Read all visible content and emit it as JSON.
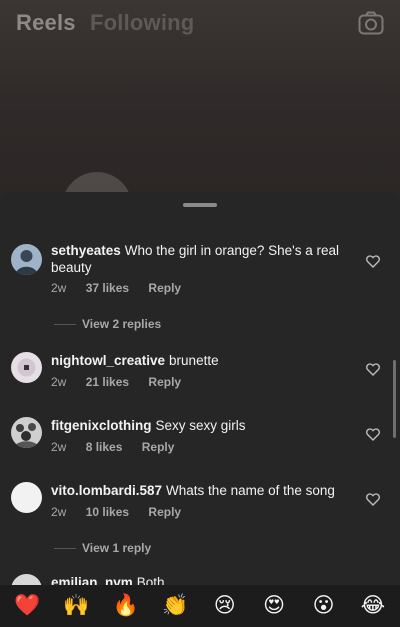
{
  "header": {
    "tabs": [
      {
        "label": "Reels"
      },
      {
        "label": "Following"
      }
    ]
  },
  "comments": [
    {
      "username": "sethyeates",
      "text": "Who the girl in orange? She's a real beauty",
      "time": "2w",
      "likes": "37 likes",
      "reply": "Reply",
      "view_replies": "View 2 replies"
    },
    {
      "username": "nightowl_creative",
      "text": "brunette",
      "time": "2w",
      "likes": "21 likes",
      "reply": "Reply"
    },
    {
      "username": "fitgenixclothing",
      "text": "Sexy sexy girls",
      "time": "2w",
      "likes": "8 likes",
      "reply": "Reply"
    },
    {
      "username": "vito.lombardi.587",
      "text": "Whats the name of the song",
      "time": "2w",
      "likes": "10 likes",
      "reply": "Reply",
      "view_replies": "View 1 reply"
    },
    {
      "username": "emilian_nvm",
      "text": "Both"
    }
  ],
  "emoji_bar": [
    "❤️",
    "🙌",
    "🔥",
    "👏",
    "😢",
    "😍",
    "😮",
    "😂"
  ],
  "colors": {
    "sheet_background": "#262626",
    "secondary_text": "#a8a8a8"
  }
}
